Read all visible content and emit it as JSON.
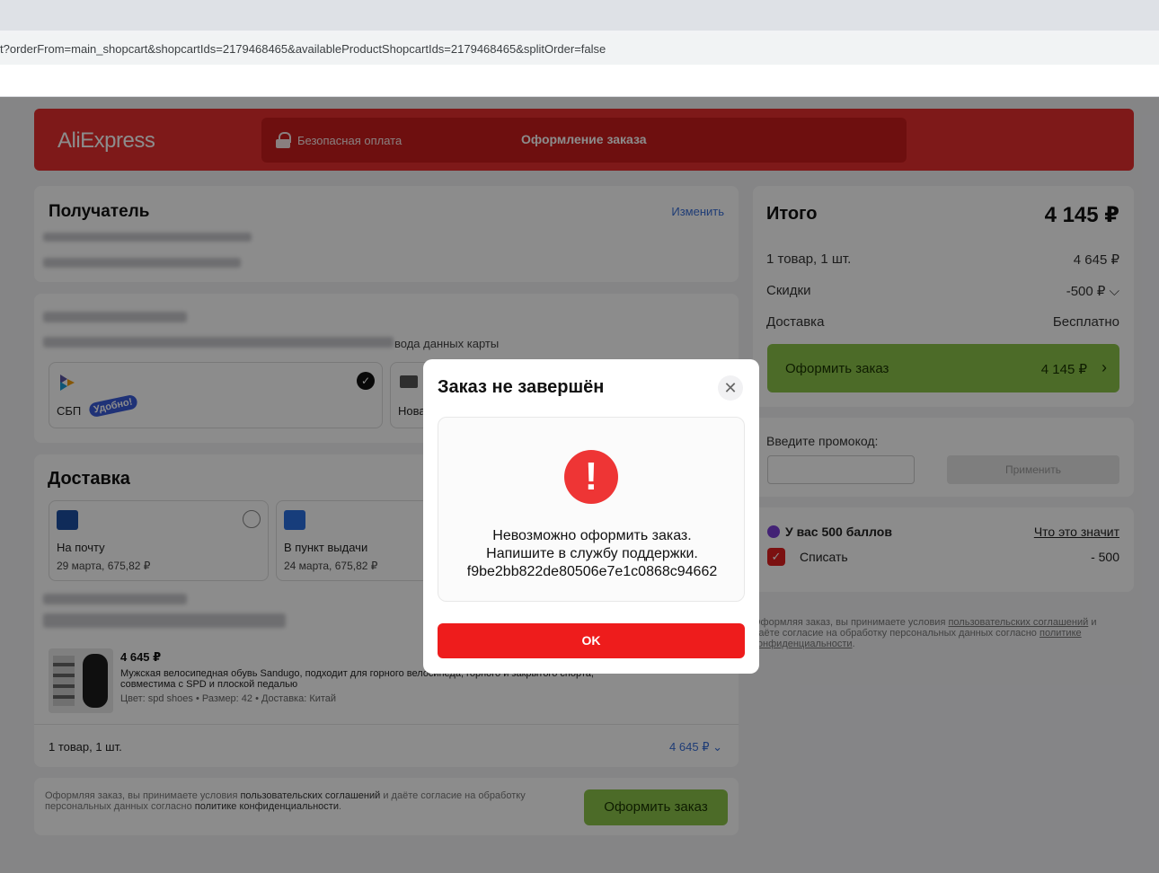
{
  "browser": {
    "url": "t?orderFrom=main_shopcart&shopcartIds=2179468465&availableProductShopcartIds=2179468465&splitOrder=false"
  },
  "header": {
    "logo": "AliExpress",
    "secure": "Безопасная оплата",
    "title": "Оформление заказа"
  },
  "recipient": {
    "title": "Получатель",
    "edit": "Изменить"
  },
  "payment": {
    "hint_tail": "вода данных карты",
    "sbp_label": "СБП",
    "sbp_badge": "Удобно!",
    "new_card_label": "Нова"
  },
  "delivery": {
    "title": "Доставка",
    "options": [
      {
        "label": "На почту",
        "sub": "29 марта, 675,82 ₽"
      },
      {
        "label": "В пункт выдачи",
        "sub": "24 марта, 675,82 ₽"
      }
    ]
  },
  "product": {
    "price": "4 645 ₽",
    "name": "Мужская велосипедная обувь Sandugo, подходит для горного велосипеда, горного и закрытого спорта, совместима с SPD и плоской педалью",
    "meta": "Цвет: spd shoes • Размер: 42 • Доставка: Китай",
    "count": "1 товар, 1 шт.",
    "total": "4 645 ₽"
  },
  "bottom": {
    "terms_prefix": "Оформляя заказ, вы принимаете условия ",
    "terms_link": "пользовательских соглашений",
    "terms_mid": " и даёте согласие на обработку персональных данных согласно ",
    "privacy_link": "политике конфиденциальности",
    "terms_end": ".",
    "submit": "Оформить заказ"
  },
  "summary": {
    "title": "Итого",
    "total": "4 145 ₽",
    "items_label": "1 товар, 1 шт.",
    "items_value": "4 645 ₽",
    "discount_label": "Скидки",
    "discount_value": "-500 ₽",
    "shipping_label": "Доставка",
    "shipping_value": "Бесплатно",
    "submit_label": "Оформить заказ",
    "submit_value": "4 145 ₽"
  },
  "promo": {
    "label": "Введите промокод:",
    "apply": "Применить"
  },
  "points": {
    "title": "У вас 500 баллов",
    "what": "Что это значит",
    "spend_label": "Списать",
    "spend_value": "- 500"
  },
  "side_terms": {
    "prefix": "Оформляя заказ, вы принимаете условия ",
    "link1": "пользовательских соглашений",
    "mid": " и даёте согласие на обработку персональных данных согласно ",
    "link2": "политике конфиденциальности",
    "end": "."
  },
  "modal": {
    "title": "Заказ не завершён",
    "line1": "Невозможно оформить заказ.",
    "line2": "Напишите в службу поддержки.",
    "code": "f9be2bb822de80506e7e1c0868c94662",
    "ok": "OK"
  }
}
